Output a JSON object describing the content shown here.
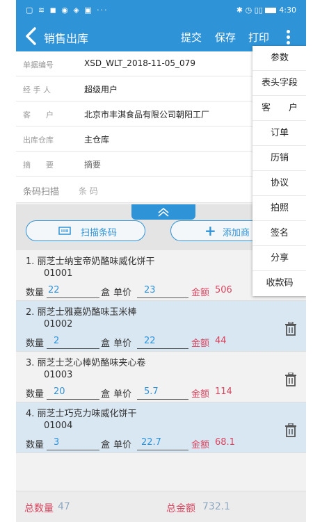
{
  "status_bar": {
    "left_icons": "▢ ≋ ◼ ◉ ◈ ▣ ···",
    "right_icons": "✱ ◷ ▯▯",
    "time": "4:30"
  },
  "appbar": {
    "title": "销售出库",
    "actions": [
      "提交",
      "保存",
      "打印"
    ]
  },
  "form": {
    "rows": [
      {
        "label": "单据编号",
        "value": "XSD_WLT_2018-11-05_079"
      },
      {
        "label": "经 手 人",
        "value": "超级用户"
      },
      {
        "label": "客　　户",
        "value": "北京市丰淇食品有限公司朝阳工厂"
      },
      {
        "label": "出库仓库",
        "value": "主仓库"
      },
      {
        "label": "摘　　要",
        "value": "摘要"
      }
    ],
    "scan_label": "条码扫描",
    "scan_placeholder": "条 码"
  },
  "buttons": {
    "scan_barcode": "扫描条码",
    "add_product": "添加商"
  },
  "units": {
    "qty": "数量",
    "box": "盒",
    "price": "单价",
    "amount": "金额"
  },
  "items": [
    {
      "name": "1.  丽芝士纳宝帝奶酪味威化饼干",
      "code": "01001",
      "qty": "22",
      "price": "23",
      "amount": "506"
    },
    {
      "name": "2.  丽芝士雅嘉奶酪味玉米棒",
      "code": "01002",
      "qty": "2",
      "price": "22",
      "amount": "44"
    },
    {
      "name": "3.  丽芝士芝心棒奶酪味夹心卷",
      "code": "01003",
      "qty": "20",
      "price": "5.7",
      "amount": "114"
    },
    {
      "name": "4.  丽芝士巧克力味威化饼干",
      "code": "01004",
      "qty": "3",
      "price": "22.7",
      "amount": "68.1"
    }
  ],
  "footer": {
    "total_qty_label": "总数量",
    "total_qty": "47",
    "total_amount_label": "总金额",
    "total_amount": "732.1"
  },
  "menu": [
    "参数",
    "表头字段",
    "客　　户",
    "订单",
    "历销",
    "协议",
    "拍照",
    "签名",
    "分享",
    "收款码"
  ],
  "colors": {
    "primary": "#2f93d8",
    "amount": "#d9455f",
    "row_alt": "#d9e7f2"
  }
}
